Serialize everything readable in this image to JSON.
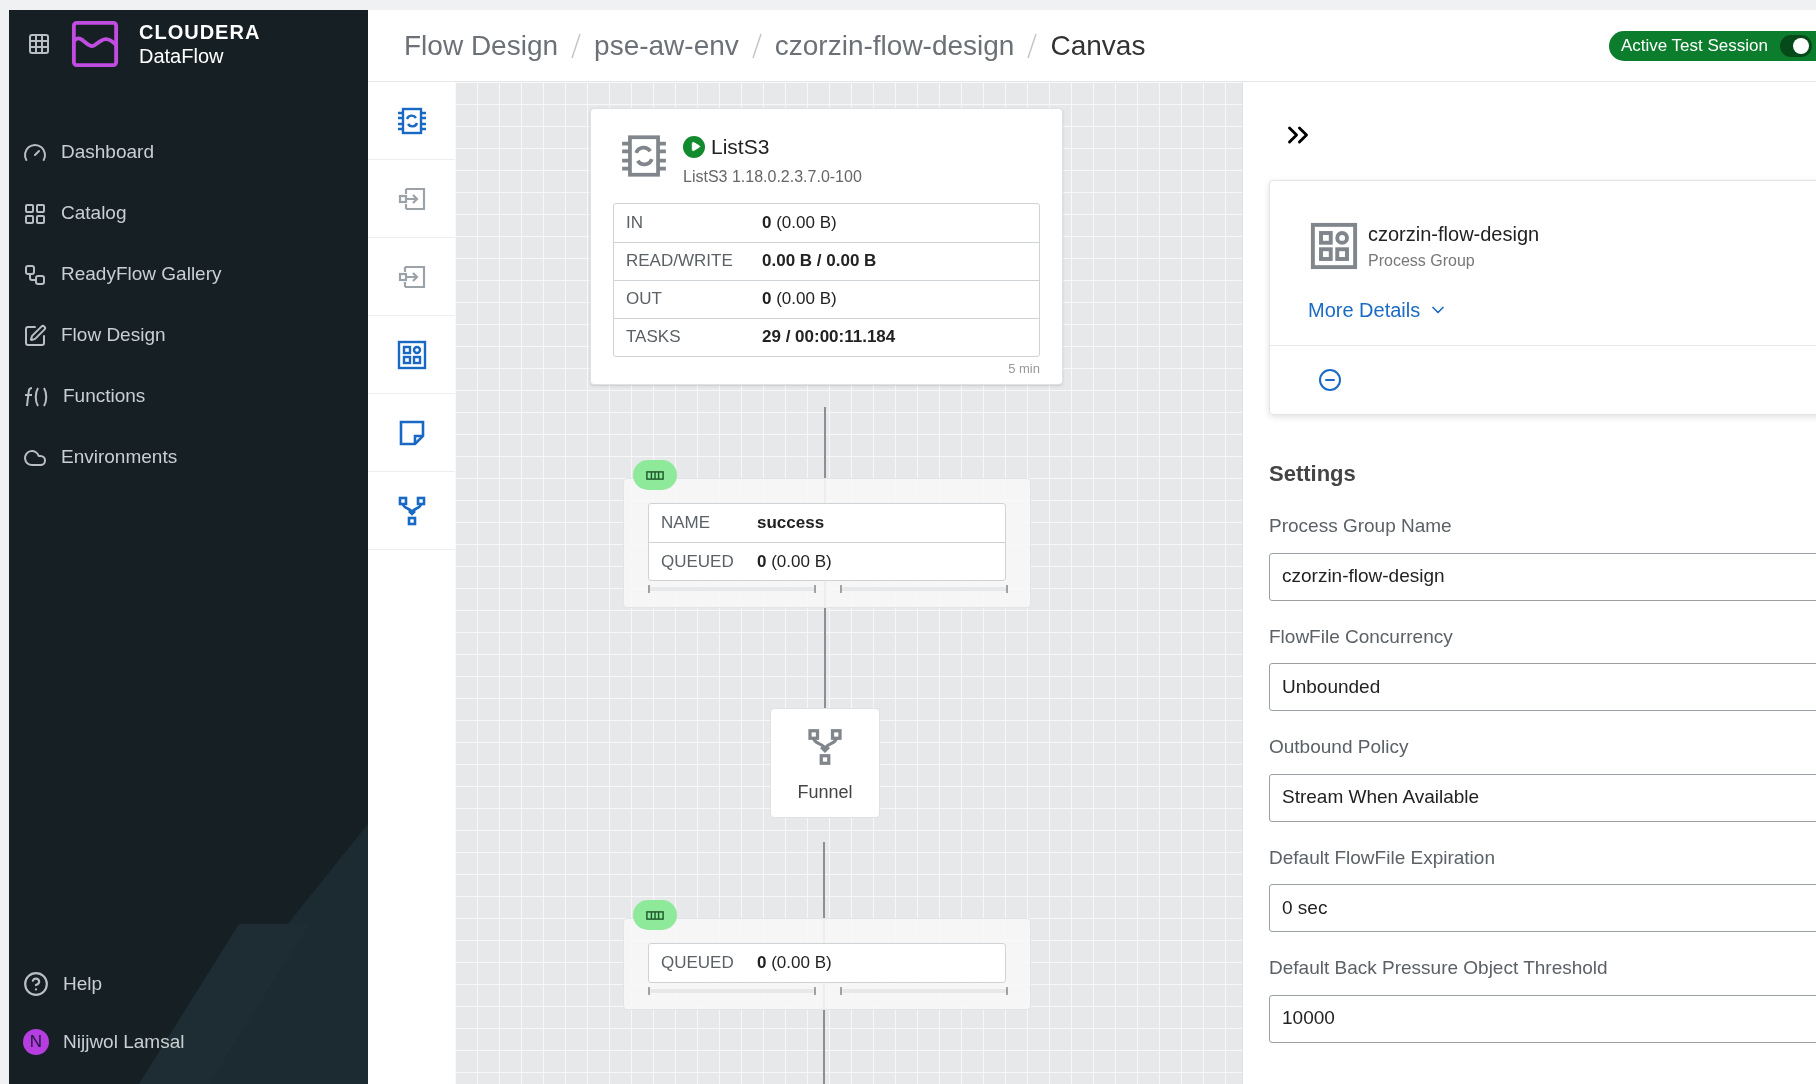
{
  "brand": {
    "company": "CLOUDERA",
    "product": "DataFlow"
  },
  "sidebar": {
    "items": [
      {
        "kind": "dashboard",
        "label": "Dashboard"
      },
      {
        "kind": "catalog",
        "label": "Catalog"
      },
      {
        "kind": "gallery",
        "label": "ReadyFlow Gallery"
      },
      {
        "kind": "design",
        "label": "Flow Design"
      },
      {
        "kind": "functions",
        "label": "Functions"
      },
      {
        "kind": "environments",
        "label": "Environments"
      }
    ],
    "help": "Help",
    "user": {
      "initial": "N",
      "name": "Nijjwol Lamsal"
    }
  },
  "breadcrumbs": [
    {
      "label": "Flow Design",
      "current": false
    },
    {
      "label": "pse-aw-env",
      "current": false
    },
    {
      "label": "czorzin-flow-design",
      "current": false
    },
    {
      "label": "Canvas",
      "current": true
    }
  ],
  "test_session": {
    "label": "Active Test Session",
    "on": true
  },
  "toolbar": [
    {
      "kind": "processor",
      "disabled": false
    },
    {
      "kind": "input-port",
      "disabled": true
    },
    {
      "kind": "output-port",
      "disabled": true
    },
    {
      "kind": "process-group",
      "disabled": false
    },
    {
      "kind": "label",
      "disabled": false
    },
    {
      "kind": "funnel",
      "disabled": false
    }
  ],
  "processor": {
    "name": "ListS3",
    "running": true,
    "type": "ListS3 1.18.0.2.3.7.0-100",
    "stats": [
      {
        "label": "IN",
        "value": "0",
        "detail": " (0.00 B)"
      },
      {
        "label": "READ/WRITE",
        "value": "0.00 B / 0.00 B"
      },
      {
        "label": "OUT",
        "value": "0",
        "detail": " (0.00 B)"
      },
      {
        "label": "TASKS",
        "value": "29 / 00:00:11.184"
      }
    ],
    "window": "5 min"
  },
  "connections": [
    {
      "rows": [
        {
          "label": "NAME",
          "value": "success"
        },
        {
          "label": "QUEUED",
          "value": "0",
          "detail": " (0.00 B)"
        }
      ]
    },
    {
      "rows": [
        {
          "label": "QUEUED",
          "value": "0",
          "detail": " (0.00 B)"
        }
      ]
    }
  ],
  "funnel": {
    "label": "Funnel"
  },
  "panel": {
    "name": "czorzin-flow-design",
    "type": "Process Group",
    "more": "More Details",
    "settings_title": "Settings",
    "fields": [
      {
        "label": "Process Group Name",
        "value": "czorzin-flow-design"
      },
      {
        "label": "FlowFile Concurrency",
        "value": "Unbounded"
      },
      {
        "label": "Outbound Policy",
        "value": "Stream When Available"
      },
      {
        "label": "Default FlowFile Expiration",
        "value": "0 sec"
      },
      {
        "label": "Default Back Pressure Object Threshold",
        "value": "10000"
      }
    ]
  }
}
